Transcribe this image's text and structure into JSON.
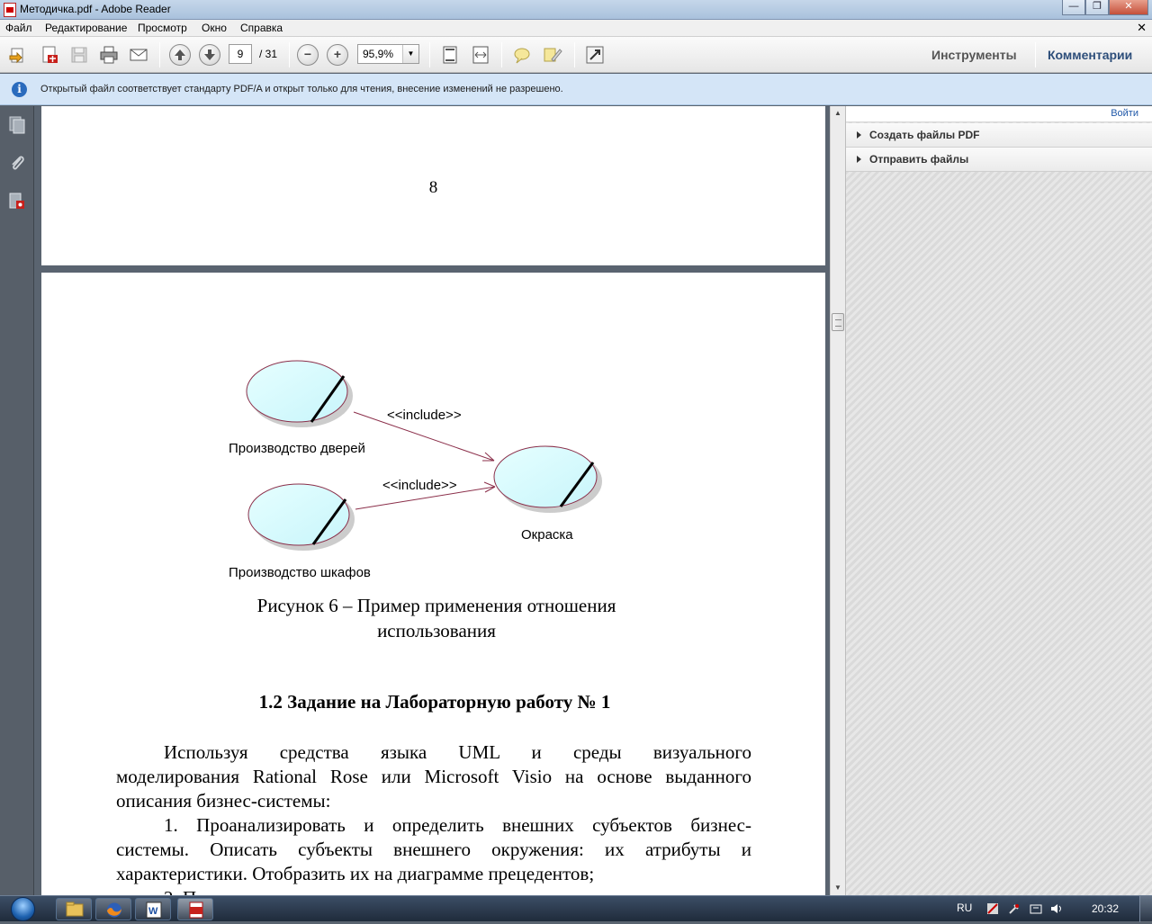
{
  "window": {
    "title": "Методичка.pdf - Adobe Reader",
    "controls": {
      "minimize": "—",
      "maximize": "❐",
      "close": "✕"
    }
  },
  "menu": {
    "items": [
      "Файл",
      "Редактирование",
      "Просмотр",
      "Окно",
      "Справка"
    ],
    "close_glyph": "✕"
  },
  "toolbar": {
    "current_page": "9",
    "total_pages": "/ 31",
    "zoom": "95,9%",
    "zoom_out_glyph": "−",
    "zoom_in_glyph": "+",
    "tools_label": "Инструменты",
    "comments_label": "Комментарии"
  },
  "infobar": {
    "message": "Открытый файл соответствует стандарту PDF/A и открыт только для чтения, внесение изменений не разрешено.",
    "icon": "info-icon"
  },
  "right_panel": {
    "signin": "Войти",
    "sections": [
      "Создать файлы PDF",
      "Отправить файлы"
    ]
  },
  "document": {
    "prev_page_number": "8",
    "diagram": {
      "use_cases": [
        "Производство дверей",
        "Производство шкафов",
        "Окраска"
      ],
      "relations": [
        "<<include>>",
        "<<include>>"
      ]
    },
    "caption_line1": "Рисунок 6 – Пример применения отношения",
    "caption_line2": "использования",
    "heading": "1.2 Задание на Лабораторную работу № 1",
    "paragraph_lines": [
      "Используя средства языка UML и среды визуального",
      "моделирования Rational Rose или Microsoft Visio на основе выданного",
      "описания бизнес-системы:",
      "1. Проанализировать и определить внешних субъектов бизнес-",
      "системы. Описать субъекты внешнего окружения: их атрибуты и",
      "характеристики. Отобразить их на диаграмме прецедентов;",
      "2. П"
    ]
  },
  "taskbar": {
    "language": "RU",
    "time": "20:32"
  }
}
